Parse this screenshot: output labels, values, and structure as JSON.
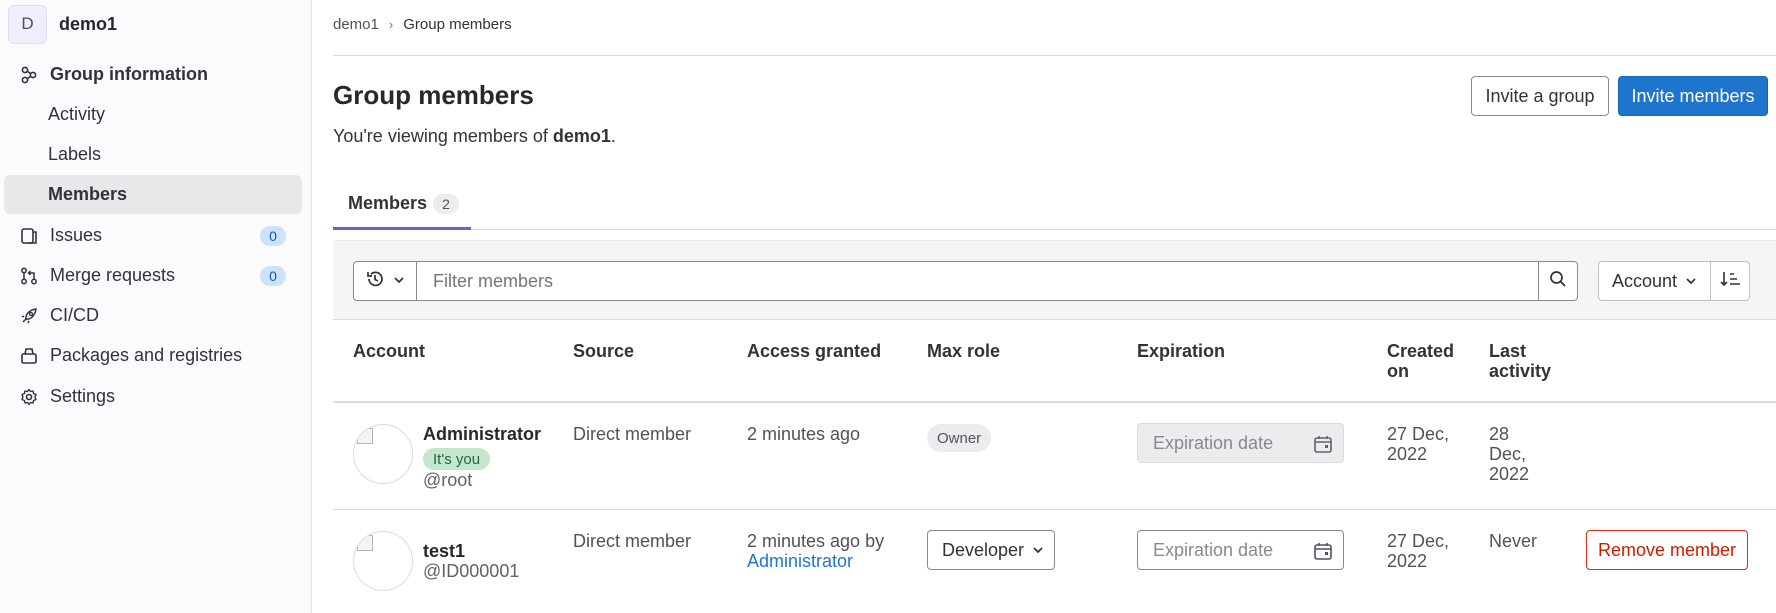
{
  "sidebar": {
    "avatar_letter": "D",
    "group_name": "demo1",
    "items": [
      {
        "label": "Group information",
        "icon": "group-icon"
      },
      {
        "label": "Activity"
      },
      {
        "label": "Labels"
      },
      {
        "label": "Members"
      },
      {
        "label": "Issues",
        "icon": "issues-icon",
        "count": "0"
      },
      {
        "label": "Merge requests",
        "icon": "merge-request-icon",
        "count": "0"
      },
      {
        "label": "CI/CD",
        "icon": "rocket-icon"
      },
      {
        "label": "Packages and registries",
        "icon": "package-icon"
      },
      {
        "label": "Settings",
        "icon": "gear-icon"
      }
    ]
  },
  "breadcrumb": {
    "parent": "demo1",
    "separator": "›",
    "current": "Group members"
  },
  "header": {
    "title": "Group members",
    "subtitle_prefix": "You're viewing members of ",
    "subtitle_group": "demo1",
    "subtitle_suffix": ".",
    "invite_group_label": "Invite a group",
    "invite_members_label": "Invite members"
  },
  "tabs": [
    {
      "label": "Members",
      "count": "2"
    }
  ],
  "filter": {
    "placeholder": "Filter members",
    "sort_label": "Account"
  },
  "table": {
    "headers": {
      "account": "Account",
      "source": "Source",
      "access_granted": "Access granted",
      "max_role": "Max role",
      "expiration": "Expiration",
      "created_on_line1": "Created",
      "created_on_line2": "on",
      "last_activity_line1": "Last",
      "last_activity_line2": "activity"
    },
    "rows": [
      {
        "name": "Administrator",
        "badge": "It's you",
        "username": "@root",
        "source": "Direct member",
        "access_granted": "2 minutes ago",
        "access_by": "",
        "role": "Owner",
        "expiration_placeholder": "Expiration date",
        "created_line1": "27 Dec,",
        "created_line2": "2022",
        "last_line1": "28",
        "last_line2": "Dec,",
        "last_line3": "2022"
      },
      {
        "name": "test1",
        "username": "@ID000001",
        "source": "Direct member",
        "access_granted": "2 minutes ago by",
        "access_by": "Administrator",
        "role": "Developer",
        "expiration_placeholder": "Expiration date",
        "created_line1": "27 Dec,",
        "created_line2": "2022",
        "last_line1": "Never",
        "remove_label": "Remove member"
      }
    ]
  },
  "colors": {
    "primary": "#1f75cb",
    "tab_active": "#6666c4",
    "danger": "#dd2b0e",
    "you_badge_bg": "#c3e6cd"
  }
}
